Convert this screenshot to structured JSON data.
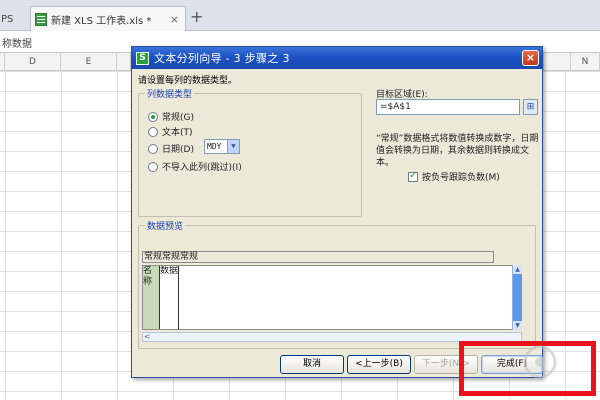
{
  "tabs": {
    "prev_label": "PS",
    "active_label": "新建 XLS 工作表.xls *",
    "close_glyph": "×",
    "add_glyph": "+"
  },
  "namebar": {
    "text": "称数据"
  },
  "columns": [
    "D",
    "E",
    "N"
  ],
  "dialog": {
    "title": "文本分列向导 - 3 步骤之 3",
    "close_glyph": "×",
    "instruction": "请设置每列的数据类型。",
    "column_type_group": {
      "title": "列数据类型",
      "options": [
        {
          "label": "常规(G)",
          "selected": true
        },
        {
          "label": "文本(T)",
          "selected": false
        },
        {
          "label": "日期(D)",
          "selected": false
        },
        {
          "label": "不导入此列(跳过)(I)",
          "selected": false
        }
      ],
      "date_format": "MDY",
      "dropdown_glyph": "▼"
    },
    "destination": {
      "label": "目标区域(E):",
      "value": "=$A$1",
      "picker_glyph": "⊞"
    },
    "description": "“常规”数据格式将数值转换成数字，日期值会转换为日期，其余数据则转换成文本。",
    "negative_checkbox": {
      "label": "按负号跟踪负数(M)",
      "checked": true
    },
    "preview": {
      "title": "数据预览",
      "ruler": "常规常规常规",
      "cells": [
        "名称",
        "数据"
      ],
      "scroll_up": "▲",
      "scroll_down": "▼",
      "scroll_left": "<"
    },
    "buttons": {
      "cancel": "取消",
      "back": "<上一步(B)",
      "next": "下一步(N)>",
      "finish": "完成(F)"
    }
  },
  "colors": {
    "highlight": "#e8131b",
    "title_bar": "#1d52c4",
    "dialog_bg": "#ece9d8"
  }
}
